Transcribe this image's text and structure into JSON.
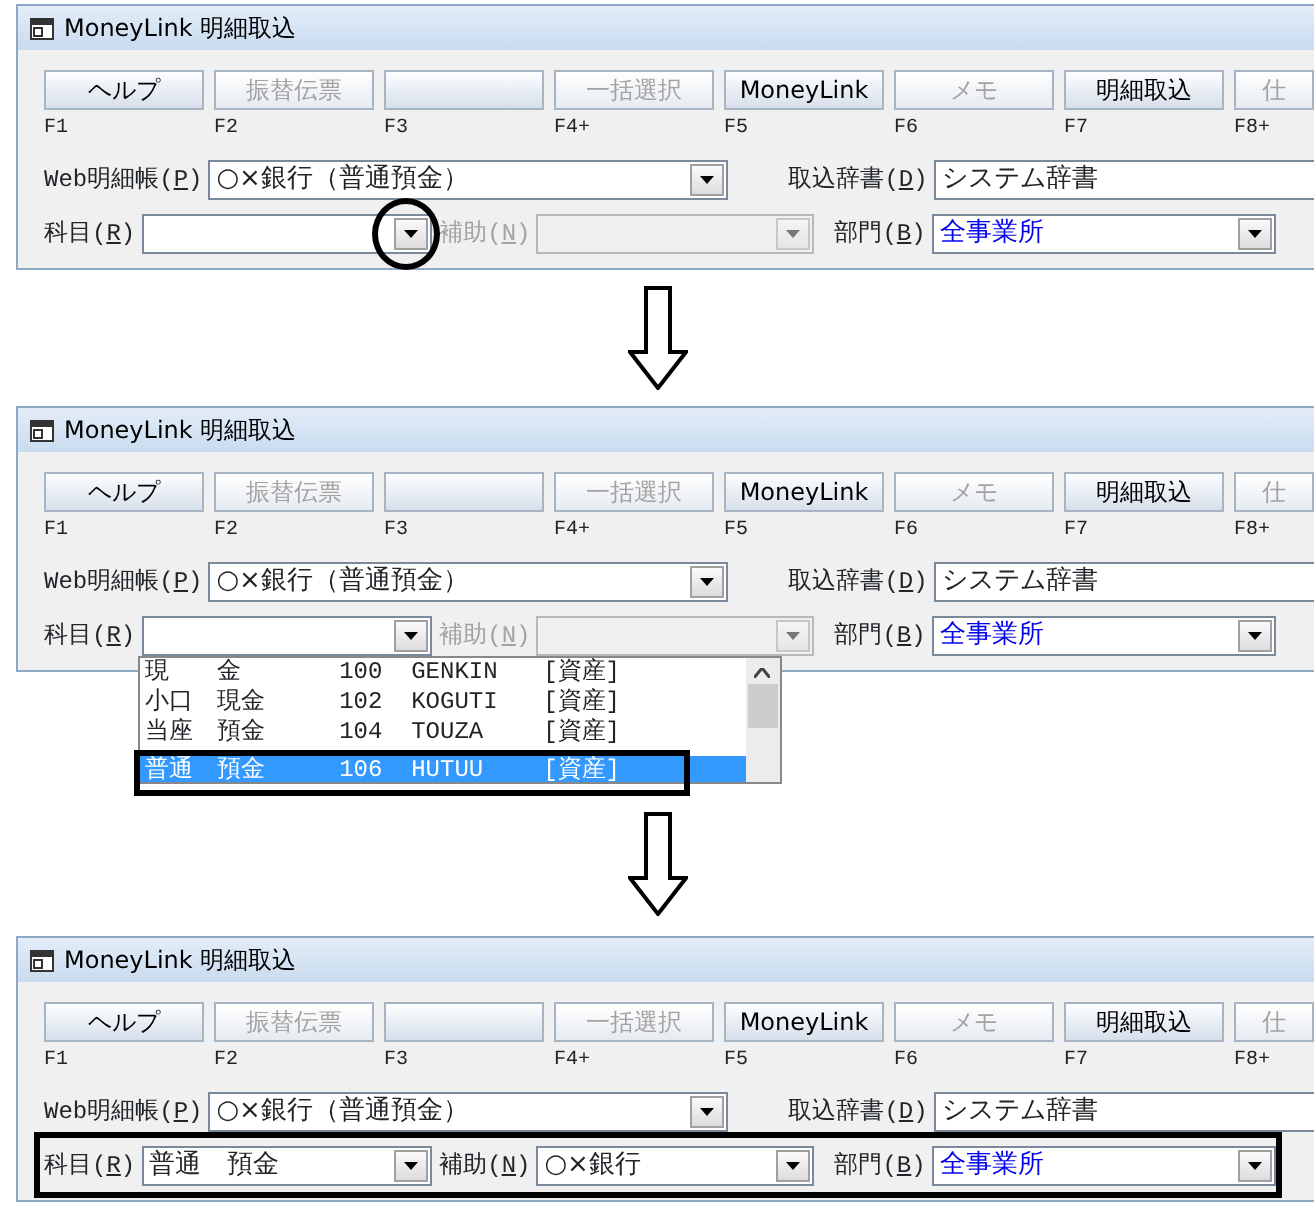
{
  "panels": [
    {
      "title": "MoneyLink 明細取込",
      "buttons": [
        {
          "label": "ヘルプ",
          "disabled": false
        },
        {
          "label": "振替伝票",
          "disabled": true
        },
        {
          "disabled": false
        },
        {
          "label": "一括選択",
          "disabled": true
        },
        {
          "label": "MoneyLink",
          "disabled": false
        },
        {
          "label": "メモ",
          "disabled": true
        },
        {
          "label": "明細取込",
          "disabled": false
        },
        {
          "label": "仕",
          "disabled": true
        }
      ],
      "function_keys": [
        "F1",
        "F2",
        "F3",
        "F4+",
        "F5",
        "F6",
        "F7",
        "F8+"
      ],
      "statement": {
        "label": [
          "Web明細帳(",
          "P",
          ")"
        ],
        "value": "○×銀行（普通預金）"
      },
      "dictionary": {
        "label": [
          "取込辞書(",
          "D",
          ")"
        ],
        "value": "システム辞書"
      },
      "fields_outlined": false,
      "fields": [
        {
          "label": [
            "科目(",
            "R",
            ")"
          ],
          "disabled": false,
          "circled": true
        },
        {
          "label": [
            "補助(",
            "N",
            ")"
          ],
          "disabled": true,
          "circled": false
        },
        {
          "label": [
            "部門(",
            "B",
            ")"
          ],
          "value": "全事業所",
          "disabled": false,
          "circled": false
        }
      ]
    },
    {
      "title": "MoneyLink 明細取込",
      "buttons": [
        {
          "label": "ヘルプ",
          "disabled": false
        },
        {
          "label": "振替伝票",
          "disabled": true
        },
        {
          "disabled": false
        },
        {
          "label": "一括選択",
          "disabled": true
        },
        {
          "label": "MoneyLink",
          "disabled": false
        },
        {
          "label": "メモ",
          "disabled": true
        },
        {
          "label": "明細取込",
          "disabled": false
        },
        {
          "label": "仕",
          "disabled": true
        }
      ],
      "function_keys": [
        "F1",
        "F2",
        "F3",
        "F4+",
        "F5",
        "F6",
        "F7",
        "F8+"
      ],
      "statement": {
        "label": [
          "Web明細帳(",
          "P",
          ")"
        ],
        "value": "○×銀行（普通預金）"
      },
      "dictionary": {
        "label": [
          "取込辞書(",
          "D",
          ")"
        ],
        "value": "システム辞書"
      },
      "fields_outlined": false,
      "fields": [
        {
          "label": [
            "科目(",
            "R",
            ")"
          ],
          "disabled": false,
          "circled": false,
          "list": [
            {
              "name": "現　　金",
              "code": "100",
              "reading": "GENKIN",
              "category": "[資産]",
              "selected": false,
              "outlined": false
            },
            {
              "name": "小口　現金",
              "code": "102",
              "reading": "KOGUTI",
              "category": "[資産]",
              "selected": false,
              "outlined": false
            },
            {
              "name": "当座　預金",
              "code": "104",
              "reading": "TOUZA",
              "category": "[資産]",
              "selected": false,
              "outlined": false
            },
            {
              "name": "普通　預金",
              "code": "106",
              "reading": "HUTUU",
              "category": "[資産]",
              "selected": true,
              "outlined": true
            }
          ]
        },
        {
          "label": [
            "補助(",
            "N",
            ")"
          ],
          "disabled": true,
          "circled": false
        },
        {
          "label": [
            "部門(",
            "B",
            ")"
          ],
          "value": "全事業所",
          "disabled": false,
          "circled": false
        }
      ]
    },
    {
      "title": "MoneyLink 明細取込",
      "buttons": [
        {
          "label": "ヘルプ",
          "disabled": false
        },
        {
          "label": "振替伝票",
          "disabled": true
        },
        {
          "disabled": false
        },
        {
          "label": "一括選択",
          "disabled": true
        },
        {
          "label": "MoneyLink",
          "disabled": false
        },
        {
          "label": "メモ",
          "disabled": true
        },
        {
          "label": "明細取込",
          "disabled": false
        },
        {
          "label": "仕",
          "disabled": true
        }
      ],
      "function_keys": [
        "F1",
        "F2",
        "F3",
        "F4+",
        "F5",
        "F6",
        "F7",
        "F8+"
      ],
      "statement": {
        "label": [
          "Web明細帳(",
          "P",
          ")"
        ],
        "value": "○×銀行（普通預金）"
      },
      "dictionary": {
        "label": [
          "取込辞書(",
          "D",
          ")"
        ],
        "value": "システム辞書"
      },
      "fields_outlined": true,
      "fields": [
        {
          "label": [
            "科目(",
            "R",
            ")"
          ],
          "value": "普通　預金",
          "disabled": false,
          "circled": false
        },
        {
          "label": [
            "補助(",
            "N",
            ")"
          ],
          "value": "○×銀行",
          "disabled": false,
          "circled": false
        },
        {
          "label": [
            "部門(",
            "B",
            ")"
          ],
          "value": "全事業所",
          "disabled": false,
          "circled": false
        }
      ]
    }
  ]
}
